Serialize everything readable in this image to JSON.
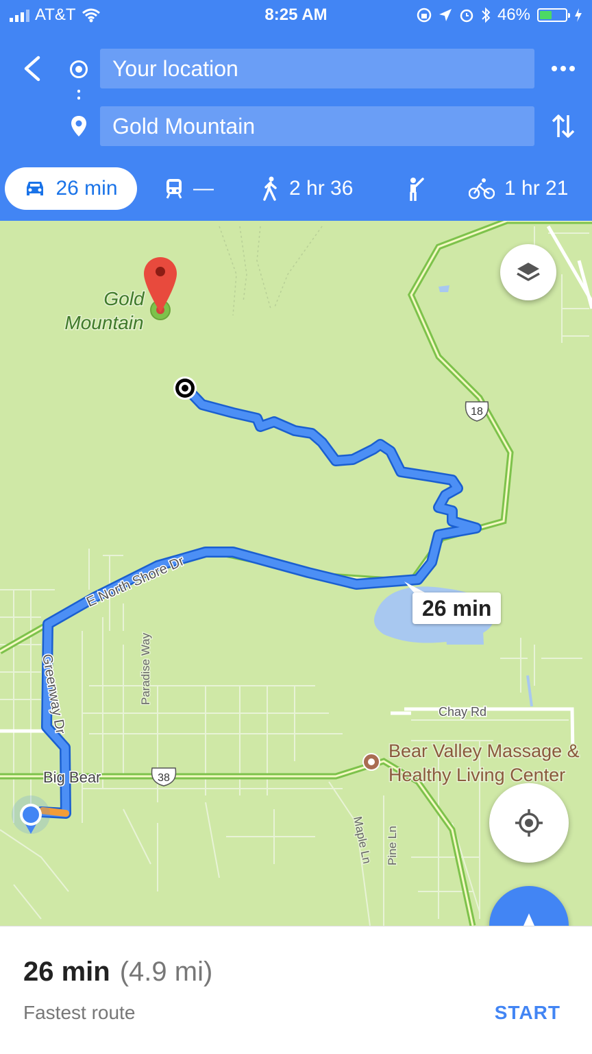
{
  "status_bar": {
    "carrier": "AT&T",
    "time": "8:25 AM",
    "battery": "46%",
    "battery_level": 0.46
  },
  "directions": {
    "origin": "Your location",
    "destination": "Gold Mountain"
  },
  "modes": [
    {
      "name": "drive",
      "label": "26 min",
      "icon": "car-icon",
      "active": true
    },
    {
      "name": "transit",
      "label": "—",
      "icon": "train-icon"
    },
    {
      "name": "walk",
      "label": "2 hr 36",
      "icon": "walk-icon"
    },
    {
      "name": "ride",
      "label": "",
      "icon": "ride-icon"
    },
    {
      "name": "bike",
      "label": "1 hr 21",
      "icon": "bike-icon"
    }
  ],
  "map": {
    "destination_label_line1": "Gold",
    "destination_label_line2": "Mountain",
    "route_callout": "26 min",
    "road_labels": {
      "north_shore": "E North Shore Dr",
      "greenway": "Greenway Dr",
      "paradise": "Paradise Way",
      "chay": "Chay Rd",
      "big_bear": "Big Bear",
      "maple": "Maple Ln",
      "pine": "Pine Ln"
    },
    "route_shields": {
      "hwy18": "18",
      "hwy38": "38"
    },
    "poi": {
      "line1": "Bear Valley Massage &",
      "line2": "Healthy Living Center"
    },
    "colors": {
      "route": "#4285f4",
      "highway": "#7dc24b",
      "water": "#a8c8f0",
      "background": "#cfe8a6"
    }
  },
  "summary": {
    "duration": "26 min",
    "distance": "(4.9 mi)",
    "subtitle": "Fastest route",
    "start_label": "START"
  }
}
